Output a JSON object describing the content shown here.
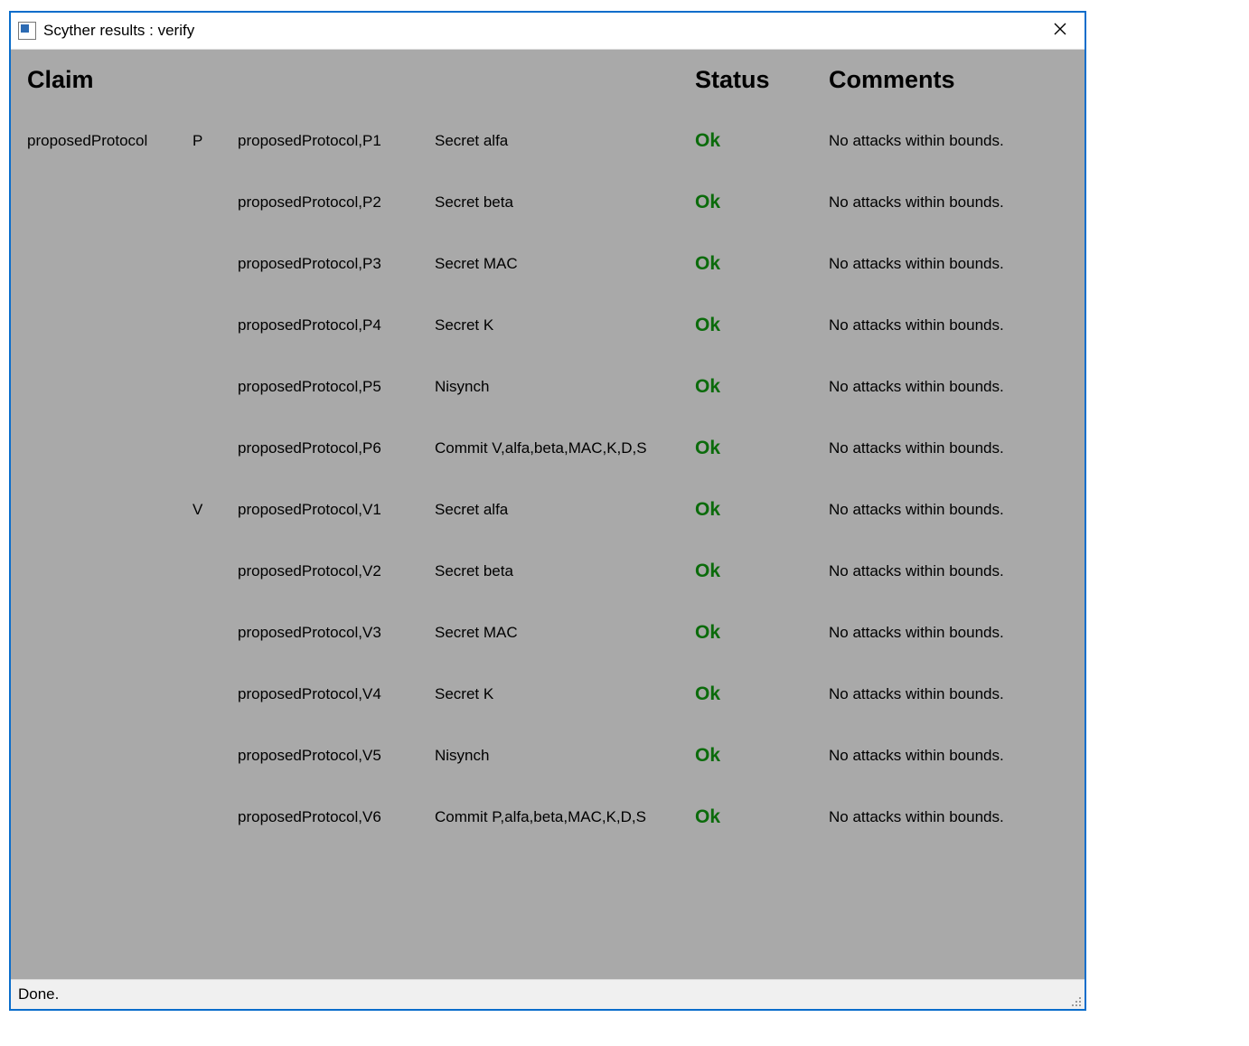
{
  "window": {
    "title": "Scyther results : verify",
    "close_label": "Close"
  },
  "headers": {
    "claim": "Claim",
    "status": "Status",
    "comments": "Comments"
  },
  "protocol": "proposedProtocol",
  "roles": [
    {
      "role": "P",
      "claims": [
        {
          "id": "proposedProtocol,P1",
          "desc": "Secret alfa",
          "status": "Ok",
          "comment": "No attacks within bounds."
        },
        {
          "id": "proposedProtocol,P2",
          "desc": "Secret beta",
          "status": "Ok",
          "comment": "No attacks within bounds."
        },
        {
          "id": "proposedProtocol,P3",
          "desc": "Secret MAC",
          "status": "Ok",
          "comment": "No attacks within bounds."
        },
        {
          "id": "proposedProtocol,P4",
          "desc": "Secret K",
          "status": "Ok",
          "comment": "No attacks within bounds."
        },
        {
          "id": "proposedProtocol,P5",
          "desc": "Nisynch",
          "status": "Ok",
          "comment": "No attacks within bounds."
        },
        {
          "id": "proposedProtocol,P6",
          "desc": "Commit V,alfa,beta,MAC,K,D,S",
          "status": "Ok",
          "comment": "No attacks within bounds."
        }
      ]
    },
    {
      "role": "V",
      "claims": [
        {
          "id": "proposedProtocol,V1",
          "desc": "Secret alfa",
          "status": "Ok",
          "comment": "No attacks within bounds."
        },
        {
          "id": "proposedProtocol,V2",
          "desc": "Secret beta",
          "status": "Ok",
          "comment": "No attacks within bounds."
        },
        {
          "id": "proposedProtocol,V3",
          "desc": "Secret MAC",
          "status": "Ok",
          "comment": "No attacks within bounds."
        },
        {
          "id": "proposedProtocol,V4",
          "desc": "Secret K",
          "status": "Ok",
          "comment": "No attacks within bounds."
        },
        {
          "id": "proposedProtocol,V5",
          "desc": "Nisynch",
          "status": "Ok",
          "comment": "No attacks within bounds."
        },
        {
          "id": "proposedProtocol,V6",
          "desc": "Commit P,alfa,beta,MAC,K,D,S",
          "status": "Ok",
          "comment": "No attacks within bounds."
        }
      ]
    }
  ],
  "statusbar": {
    "text": "Done."
  },
  "colors": {
    "window_border": "#0a6dcb",
    "panel_bg": "#a9a9a9",
    "status_ok": "#0b6b0b"
  }
}
